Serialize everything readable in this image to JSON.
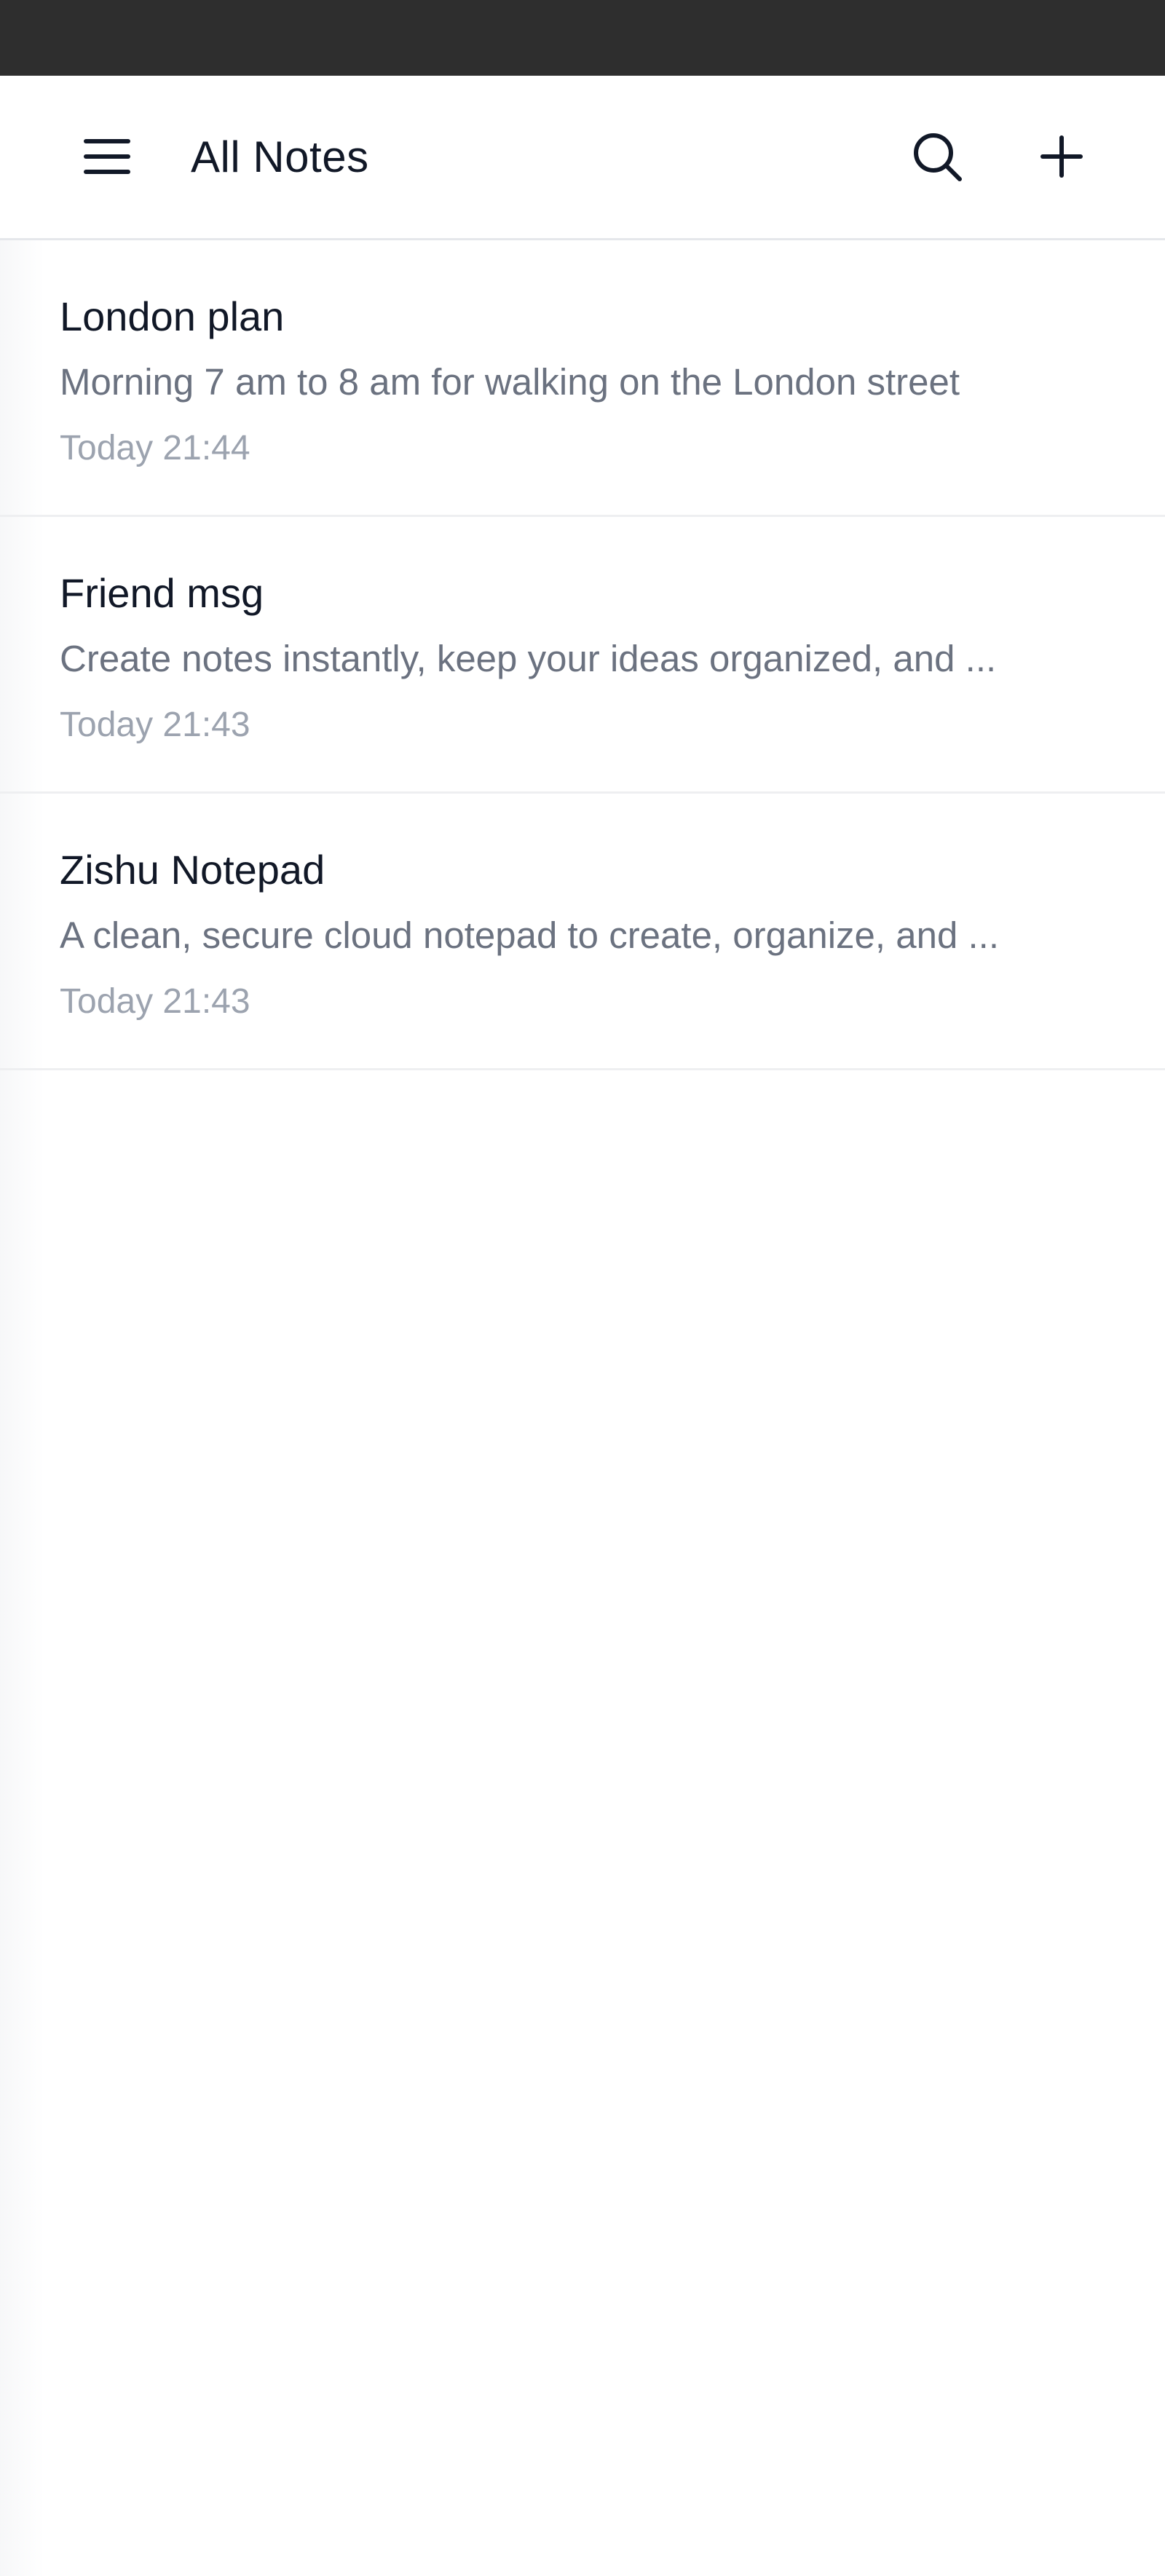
{
  "header": {
    "title": "All Notes",
    "menu_icon": "hamburger-menu-icon",
    "search_icon": "search-icon",
    "add_icon": "plus-icon"
  },
  "notes": [
    {
      "title": "London plan",
      "preview": "Morning 7 am to 8 am for walking on the London street",
      "date": "Today 21:44"
    },
    {
      "title": "Friend msg",
      "preview": "Create notes instantly, keep your ideas organized, and ...",
      "date": "Today 21:43"
    },
    {
      "title": "Zishu Notepad",
      "preview": "A clean, secure cloud notepad to create, organize, and ...",
      "date": "Today 21:43"
    }
  ],
  "colors": {
    "status_bar": "#2e2e2e",
    "title_text": "#111827",
    "preview_text": "#6b7280",
    "date_text": "#9ca3af",
    "divider": "#e5e7eb"
  }
}
